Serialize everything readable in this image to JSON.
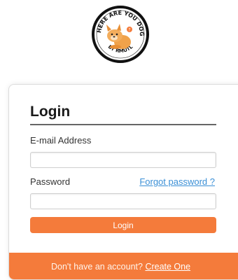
{
  "logo": {
    "top_text": "WHERE ARE YOU DOG?",
    "bottom_text": "BY RMUTL",
    "icon": "french-bulldog-icon"
  },
  "login": {
    "title": "Login",
    "email_label": "E-mail Address",
    "email_value": "",
    "password_label": "Password",
    "password_value": "",
    "forgot_link": "Forgot password ?",
    "submit_label": "Login"
  },
  "footer": {
    "prompt": "Don't have an account?",
    "create_link": "Create One"
  },
  "colors": {
    "accent": "#f47b3b",
    "link": "#3a8fd6"
  }
}
